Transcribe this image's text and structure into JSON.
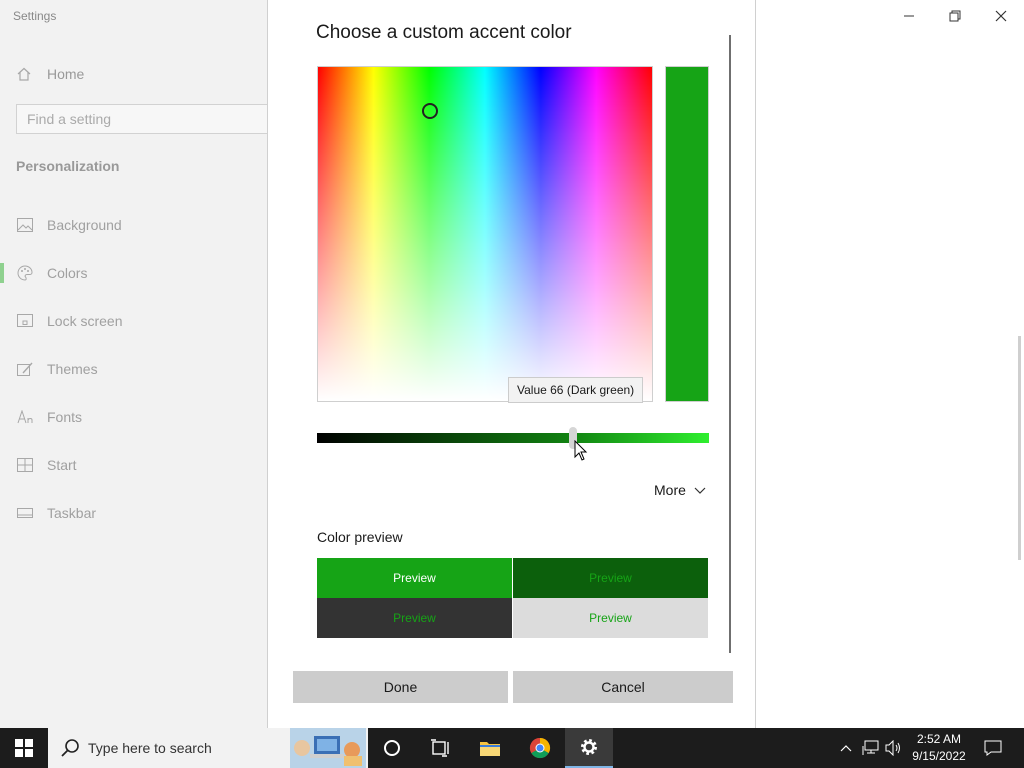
{
  "window": {
    "title": "Settings"
  },
  "sidebar": {
    "home_label": "Home",
    "search_placeholder": "Find a setting",
    "section_title": "Personalization",
    "items": [
      {
        "label": "Background",
        "icon": "image-icon"
      },
      {
        "label": "Colors",
        "icon": "palette-icon",
        "selected": true
      },
      {
        "label": "Lock screen",
        "icon": "lock-screen-icon"
      },
      {
        "label": "Themes",
        "icon": "themes-icon"
      },
      {
        "label": "Fonts",
        "icon": "fonts-icon"
      },
      {
        "label": "Start",
        "icon": "start-icon"
      },
      {
        "label": "Taskbar",
        "icon": "taskbar-icon"
      }
    ]
  },
  "dialog": {
    "title": "Choose a custom accent color",
    "tooltip": "Value 66 (Dark green)",
    "slider_value": 66,
    "more_label": "More",
    "preview_label": "Color preview",
    "preview_cells": [
      "Preview",
      "Preview",
      "Preview",
      "Preview"
    ],
    "done_label": "Done",
    "cancel_label": "Cancel",
    "accent_color": "#16a416",
    "accent_dark": "#0c600c"
  },
  "taskbar": {
    "search_text": "Type here to search",
    "time": "2:52 AM",
    "date": "9/15/2022"
  }
}
